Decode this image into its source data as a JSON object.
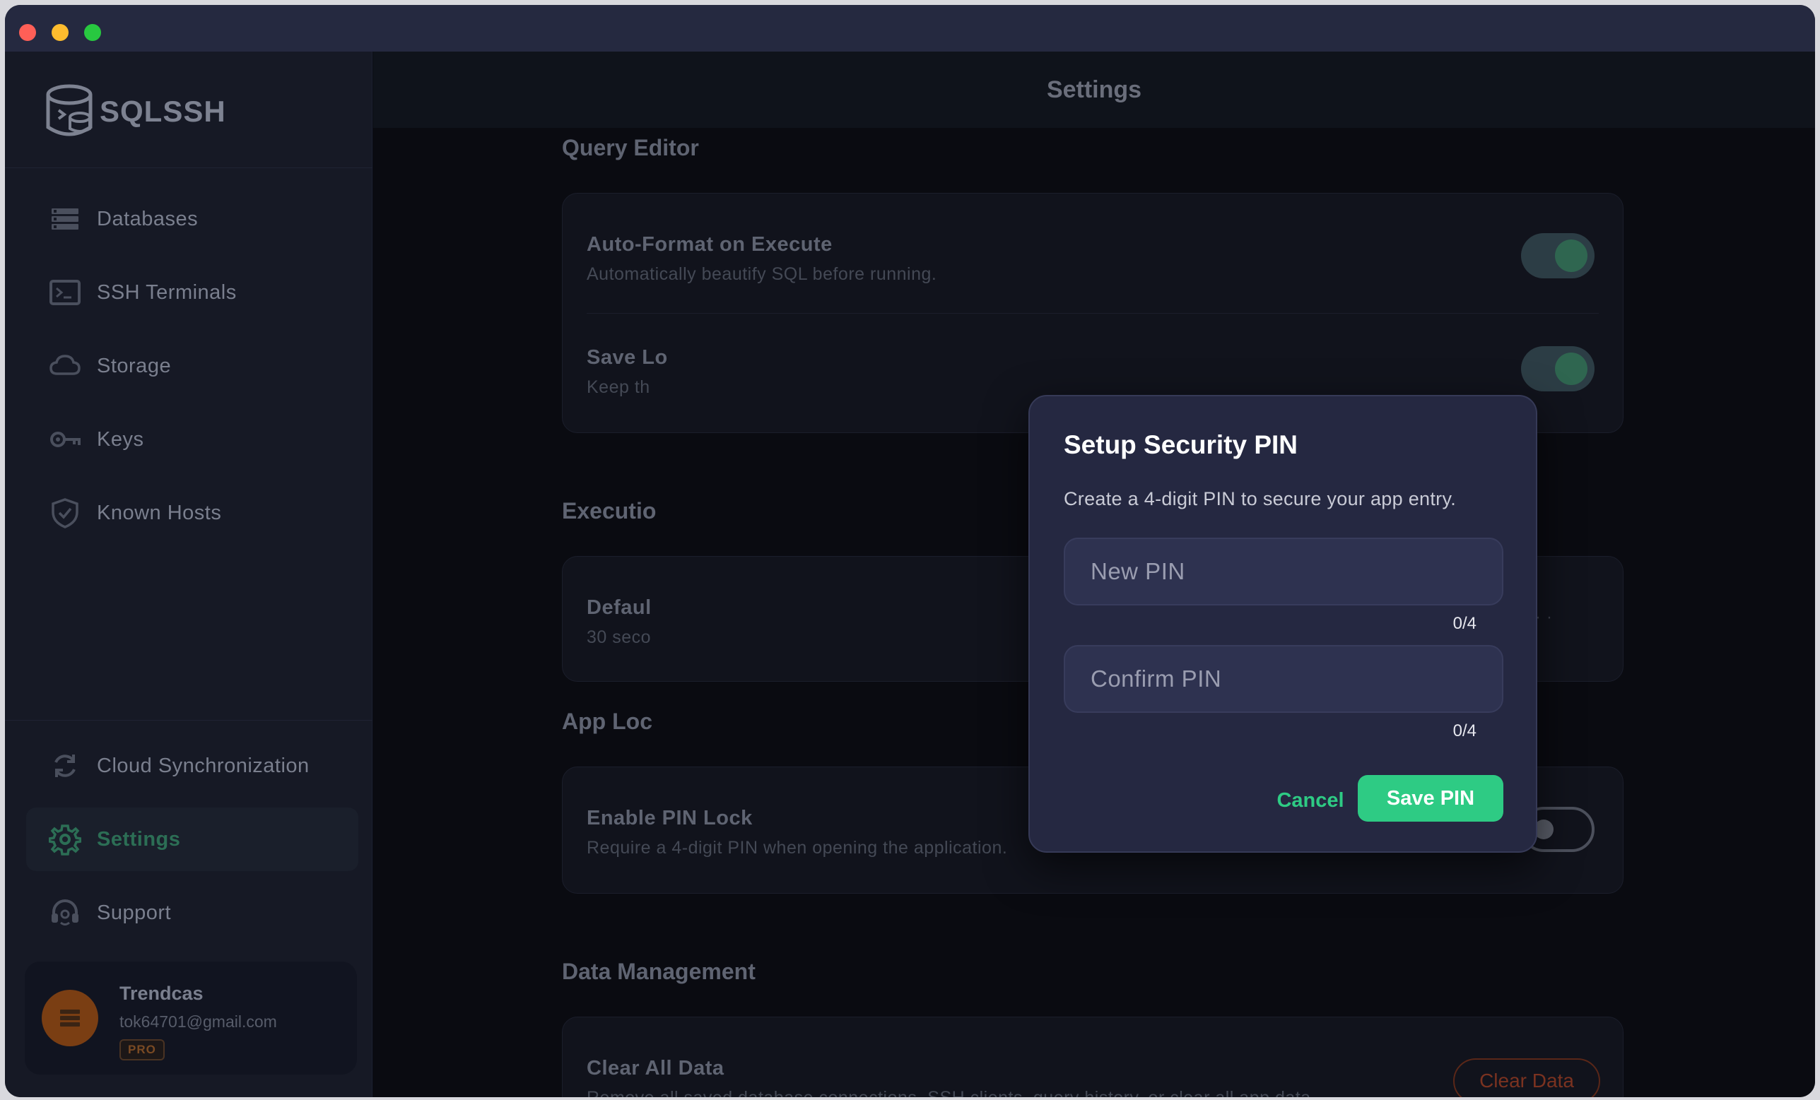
{
  "app": {
    "name": "SQLSSH"
  },
  "sidebar": {
    "items": [
      {
        "label": "Databases",
        "icon": "database-icon"
      },
      {
        "label": "SSH Terminals",
        "icon": "terminal-icon"
      },
      {
        "label": "Storage",
        "icon": "cloud-icon"
      },
      {
        "label": "Keys",
        "icon": "key-icon"
      },
      {
        "label": "Known Hosts",
        "icon": "shield-icon"
      }
    ],
    "bottom_items": [
      {
        "label": "Cloud Synchronization",
        "icon": "sync-icon"
      },
      {
        "label": "Settings",
        "icon": "gear-icon",
        "active": true
      },
      {
        "label": "Support",
        "icon": "headset-icon"
      }
    ],
    "user": {
      "name": "Trendcas",
      "email": "tok64701@gmail.com",
      "badge": "PRO"
    }
  },
  "header": {
    "title": "Settings"
  },
  "sections": {
    "query_editor": {
      "title": "Query Editor",
      "auto_format": {
        "title": "Auto-Format on Execute",
        "desc": "Automatically beautify SQL before running.",
        "enabled": true
      },
      "save_local": {
        "title": "Save Lo",
        "desc": "Keep th",
        "enabled": true
      }
    },
    "execution": {
      "title": "Executio",
      "default_timeout": {
        "title": "Defaul",
        "desc": "30 seco"
      }
    },
    "app_lock": {
      "title": "App Loc",
      "pin_lock": {
        "title": "Enable PIN Lock",
        "desc": "Require a 4-digit PIN when opening the application.",
        "enabled": false
      }
    },
    "data_management": {
      "title": "Data Management",
      "clear_all": {
        "title": "Clear All Data",
        "desc": "Remove all saved database connections, SSH clients, query history, or clear all app data.",
        "button": "Clear Data"
      }
    }
  },
  "dialog": {
    "title": "Setup Security PIN",
    "description": "Create a 4-digit PIN to secure your app entry.",
    "new_pin": {
      "placeholder": "New PIN",
      "counter": "0/4"
    },
    "confirm_pin": {
      "placeholder": "Confirm PIN",
      "counter": "0/4"
    },
    "cancel_label": "Cancel",
    "save_label": "Save PIN"
  },
  "colors": {
    "accent": "#2ecb84",
    "active_nav": "#2c6e55",
    "danger": "#7a3220",
    "dialog_bg": "#252841"
  }
}
